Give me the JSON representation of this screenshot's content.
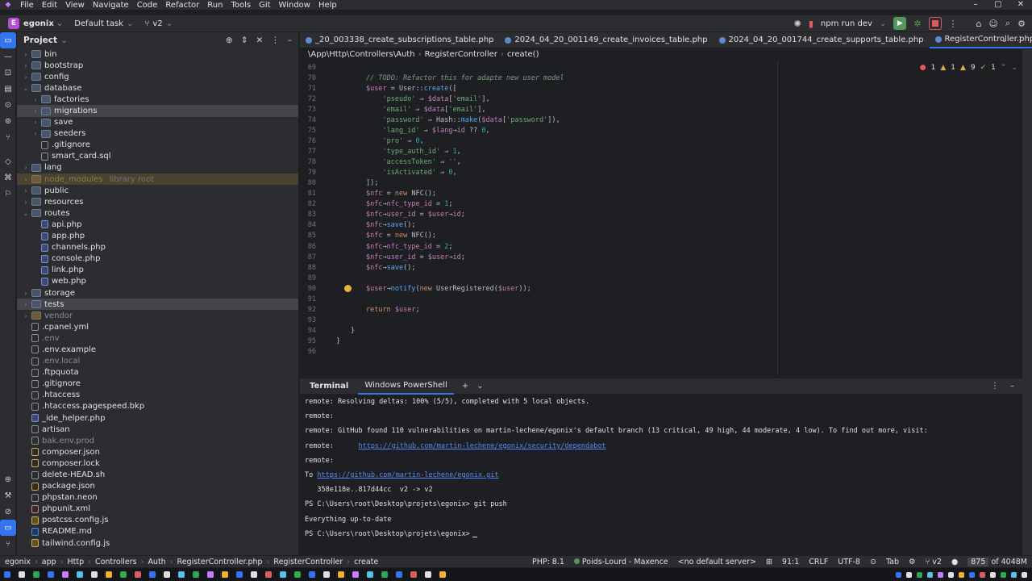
{
  "menu": [
    "File",
    "Edit",
    "View",
    "Navigate",
    "Code",
    "Refactor",
    "Run",
    "Tools",
    "Git",
    "Window",
    "Help"
  ],
  "toolbar": {
    "project_badge": "E",
    "project_name": "egonix",
    "task": "Default task",
    "branch": "v2",
    "run_config": "npm run dev"
  },
  "project_panel": {
    "title": "Project",
    "tree": [
      {
        "name": "bin",
        "type": "folder",
        "depth": 0,
        "collapsed": true
      },
      {
        "name": "bootstrap",
        "type": "folder",
        "depth": 0,
        "collapsed": true
      },
      {
        "name": "config",
        "type": "folder",
        "depth": 0,
        "collapsed": true
      },
      {
        "name": "database",
        "type": "folder",
        "depth": 0,
        "collapsed": false
      },
      {
        "name": "factories",
        "type": "folder",
        "depth": 1,
        "collapsed": true
      },
      {
        "name": "migrations",
        "type": "folder",
        "depth": 1,
        "collapsed": true,
        "selected": true
      },
      {
        "name": "save",
        "type": "folder",
        "depth": 1,
        "collapsed": true
      },
      {
        "name": "seeders",
        "type": "folder",
        "depth": 1,
        "collapsed": true
      },
      {
        "name": ".gitignore",
        "type": "file",
        "depth": 1
      },
      {
        "name": "smart_card.sql",
        "type": "file",
        "depth": 1
      },
      {
        "name": "lang",
        "type": "folder",
        "depth": 0,
        "collapsed": true
      },
      {
        "name": "node_modules",
        "type": "folder-excluded",
        "depth": 0,
        "collapsed": true,
        "extra": "library root",
        "excluded": true
      },
      {
        "name": "public",
        "type": "folder",
        "depth": 0,
        "collapsed": true
      },
      {
        "name": "resources",
        "type": "folder",
        "depth": 0,
        "collapsed": true
      },
      {
        "name": "routes",
        "type": "folder",
        "depth": 0,
        "collapsed": false
      },
      {
        "name": "api.php",
        "type": "php",
        "depth": 1
      },
      {
        "name": "app.php",
        "type": "php",
        "depth": 1
      },
      {
        "name": "channels.php",
        "type": "php",
        "depth": 1
      },
      {
        "name": "console.php",
        "type": "php",
        "depth": 1
      },
      {
        "name": "link.php",
        "type": "php",
        "depth": 1
      },
      {
        "name": "web.php",
        "type": "php",
        "depth": 1
      },
      {
        "name": "storage",
        "type": "folder",
        "depth": 0,
        "collapsed": true
      },
      {
        "name": "tests",
        "type": "folder",
        "depth": 0,
        "collapsed": true,
        "selected": true
      },
      {
        "name": "vendor",
        "type": "folder-excluded",
        "depth": 0,
        "collapsed": true,
        "dim": true
      },
      {
        "name": ".cpanel.yml",
        "type": "file",
        "depth": 0
      },
      {
        "name": ".env",
        "type": "file",
        "depth": 0,
        "dim": true
      },
      {
        "name": ".env.example",
        "type": "file",
        "depth": 0
      },
      {
        "name": ".env.local",
        "type": "file",
        "depth": 0,
        "dim": true
      },
      {
        "name": ".ftpquota",
        "type": "file",
        "depth": 0
      },
      {
        "name": ".gitignore",
        "type": "file",
        "depth": 0
      },
      {
        "name": ".htaccess",
        "type": "file",
        "depth": 0
      },
      {
        "name": ".htaccess.pagespeed.bkp",
        "type": "file",
        "depth": 0
      },
      {
        "name": "_ide_helper.php",
        "type": "php",
        "depth": 0
      },
      {
        "name": "artisan",
        "type": "file",
        "depth": 0
      },
      {
        "name": "bak.env.prod",
        "type": "file",
        "depth": 0,
        "dim": true
      },
      {
        "name": "composer.json",
        "type": "json",
        "depth": 0
      },
      {
        "name": "composer.lock",
        "type": "json",
        "depth": 0
      },
      {
        "name": "delete-HEAD.sh",
        "type": "file",
        "depth": 0
      },
      {
        "name": "package.json",
        "type": "json",
        "depth": 0
      },
      {
        "name": "phpstan.neon",
        "type": "file",
        "depth": 0
      },
      {
        "name": "phpunit.xml",
        "type": "xml",
        "depth": 0
      },
      {
        "name": "postcss.config.js",
        "type": "js",
        "depth": 0
      },
      {
        "name": "README.md",
        "type": "md",
        "depth": 0
      },
      {
        "name": "tailwind.config.js",
        "type": "js",
        "depth": 0
      }
    ]
  },
  "tabs": [
    {
      "label": "_20_003338_create_subscriptions_table.php",
      "active": false
    },
    {
      "label": "2024_04_20_001149_create_invoices_table.php",
      "active": false
    },
    {
      "label": "2024_04_20_001744_create_supports_table.php",
      "active": false
    },
    {
      "label": "RegisterController.php",
      "active": true
    }
  ],
  "breadcrumb": [
    "\\App\\Http\\Controllers\\Auth",
    "RegisterController",
    "create()"
  ],
  "inspections": {
    "errors": "1",
    "warnings_a": "1",
    "warnings_b": "9",
    "weak": "1"
  },
  "code_lines": [
    {
      "n": "69",
      "html": ""
    },
    {
      "n": "70",
      "html": "<span class=\"t-cm\">// TODO: Refactor this for adapte new user model</span>"
    },
    {
      "n": "71",
      "html": "<span class=\"t-var\">$user</span> = <span class=\"t-cls\">User</span>::<span class=\"t-fn\">create</span>(["
    },
    {
      "n": "72",
      "html": "    <span class=\"t-str\">'pseudo'</span> ⇒ <span class=\"t-var\">$data</span>[<span class=\"t-str\">'email'</span>],"
    },
    {
      "n": "73",
      "html": "    <span class=\"t-str\">'email'</span> ⇒ <span class=\"t-var\">$data</span>[<span class=\"t-str\">'email'</span>],"
    },
    {
      "n": "74",
      "html": "    <span class=\"t-str\">'password'</span> ⇒ <span class=\"t-cls\">Hash</span>::<span class=\"t-fn\">make</span>(<span class=\"t-var\">$data</span>[<span class=\"t-str\">'password'</span>]),"
    },
    {
      "n": "75",
      "html": "    <span class=\"t-str\">'lang_id'</span> ⇒ <span class=\"t-var\">$lang</span>→<span class=\"t-var\">id</span> ?? <span class=\"t-num\">0</span>,"
    },
    {
      "n": "76",
      "html": "    <span class=\"t-str\">'pro'</span> ⇒ <span class=\"t-num\">0</span>,"
    },
    {
      "n": "77",
      "html": "    <span class=\"t-str\">'type_auth_id'</span> ⇒ <span class=\"t-num\">1</span>,"
    },
    {
      "n": "78",
      "html": "    <span class=\"t-str\">'accessToken'</span> ⇒ <span class=\"t-str\">''</span>,"
    },
    {
      "n": "79",
      "html": "    <span class=\"t-str\">'isActivated'</span> ⇒ <span class=\"t-num\">0</span>,"
    },
    {
      "n": "80",
      "html": "]);"
    },
    {
      "n": "81",
      "html": "<span class=\"t-var\">$nfc</span> = <span class=\"t-kw\">new</span> <span class=\"t-cls\">NFC</span>();"
    },
    {
      "n": "82",
      "html": "<span class=\"t-var\">$nfc</span>→<span class=\"t-var\">nfc_type_id</span> = <span class=\"t-num\">1</span>;"
    },
    {
      "n": "83",
      "html": "<span class=\"t-var\">$nfc</span>→<span class=\"t-var\">user_id</span> = <span class=\"t-var\">$user</span>→<span class=\"t-var\">id</span>;"
    },
    {
      "n": "84",
      "html": "<span class=\"t-var\">$nfc</span>→<span class=\"t-fn\">save</span>();"
    },
    {
      "n": "85",
      "html": "<span class=\"t-var\">$nfc</span> = <span class=\"t-kw\">new</span> <span class=\"t-cls\">NFC</span>();"
    },
    {
      "n": "86",
      "html": "<span class=\"t-var\">$nfc</span>→<span class=\"t-var\">nfc_type_id</span> = <span class=\"t-num\">2</span>;"
    },
    {
      "n": "87",
      "html": "<span class=\"t-var\">$nfc</span>→<span class=\"t-var\">user_id</span> = <span class=\"t-var\">$user</span>→<span class=\"t-var\">id</span>;"
    },
    {
      "n": "88",
      "html": "<span class=\"t-var\">$nfc</span>→<span class=\"t-fn\">save</span>();"
    },
    {
      "n": "89",
      "html": ""
    },
    {
      "n": "90",
      "html": "<span class=\"t-var\">$user</span>→<span class=\"t-fn\">notify</span>(<span class=\"t-kw\">new</span> <span class=\"t-cls\">UserRegistered</span>(<span class=\"t-var\">$user</span>));"
    },
    {
      "n": "91",
      "html": ""
    },
    {
      "n": "92",
      "html": "<span class=\"t-kw\">return</span> <span class=\"t-var\">$user</span>;"
    },
    {
      "n": "93",
      "html": ""
    },
    {
      "n": "94",
      "html": "}",
      "indent": "outer"
    },
    {
      "n": "95",
      "html": "}",
      "indent": "class"
    },
    {
      "n": "96",
      "html": ""
    }
  ],
  "terminal": {
    "title": "Terminal",
    "tab": "Windows PowerShell",
    "lines": [
      {
        "text": "remote: Resolving deltas: 100% (5/5), completed with 5 local objects."
      },
      {
        "text": "remote:"
      },
      {
        "text": "remote: GitHub found 110 vulnerabilities on martin-lechene/egonix's default branch (13 critical, 49 high, 44 moderate, 4 low). To find out more, visit:"
      },
      {
        "text": "remote:      ",
        "link": "https://github.com/martin-lechene/egonix/security/dependabot"
      },
      {
        "text": "remote:"
      },
      {
        "text": "To ",
        "link": "https://github.com/martin-lechene/egonix.git"
      },
      {
        "text": "   358e118e..817d44cc  v2 -> v2"
      },
      {
        "text": "PS C:\\Users\\root\\Desktop\\projets\\egonix> git push"
      },
      {
        "text": "Everything up-to-date"
      },
      {
        "text": "PS C:\\Users\\root\\Desktop\\projets\\egonix>",
        "cursor": true
      }
    ]
  },
  "statusbar": {
    "nav": [
      "egonix",
      "app",
      "Http",
      "Controllers",
      "Auth",
      "RegisterController.php",
      "RegisterController",
      "create"
    ],
    "php": "PHP: 8.1",
    "remote": "Poids-Lourd - Maxence",
    "server": "<no default server>",
    "position": "91:1",
    "eol": "CRLF",
    "encoding": "UTF-8",
    "indent": "Tab",
    "branch": "v2",
    "memory_used": "875",
    "memory_total": "of 4048M"
  },
  "colors": {
    "accent": "#3574f0",
    "run": "#57965c",
    "stop": "#db5c5c",
    "brand": "#b44dd1"
  }
}
